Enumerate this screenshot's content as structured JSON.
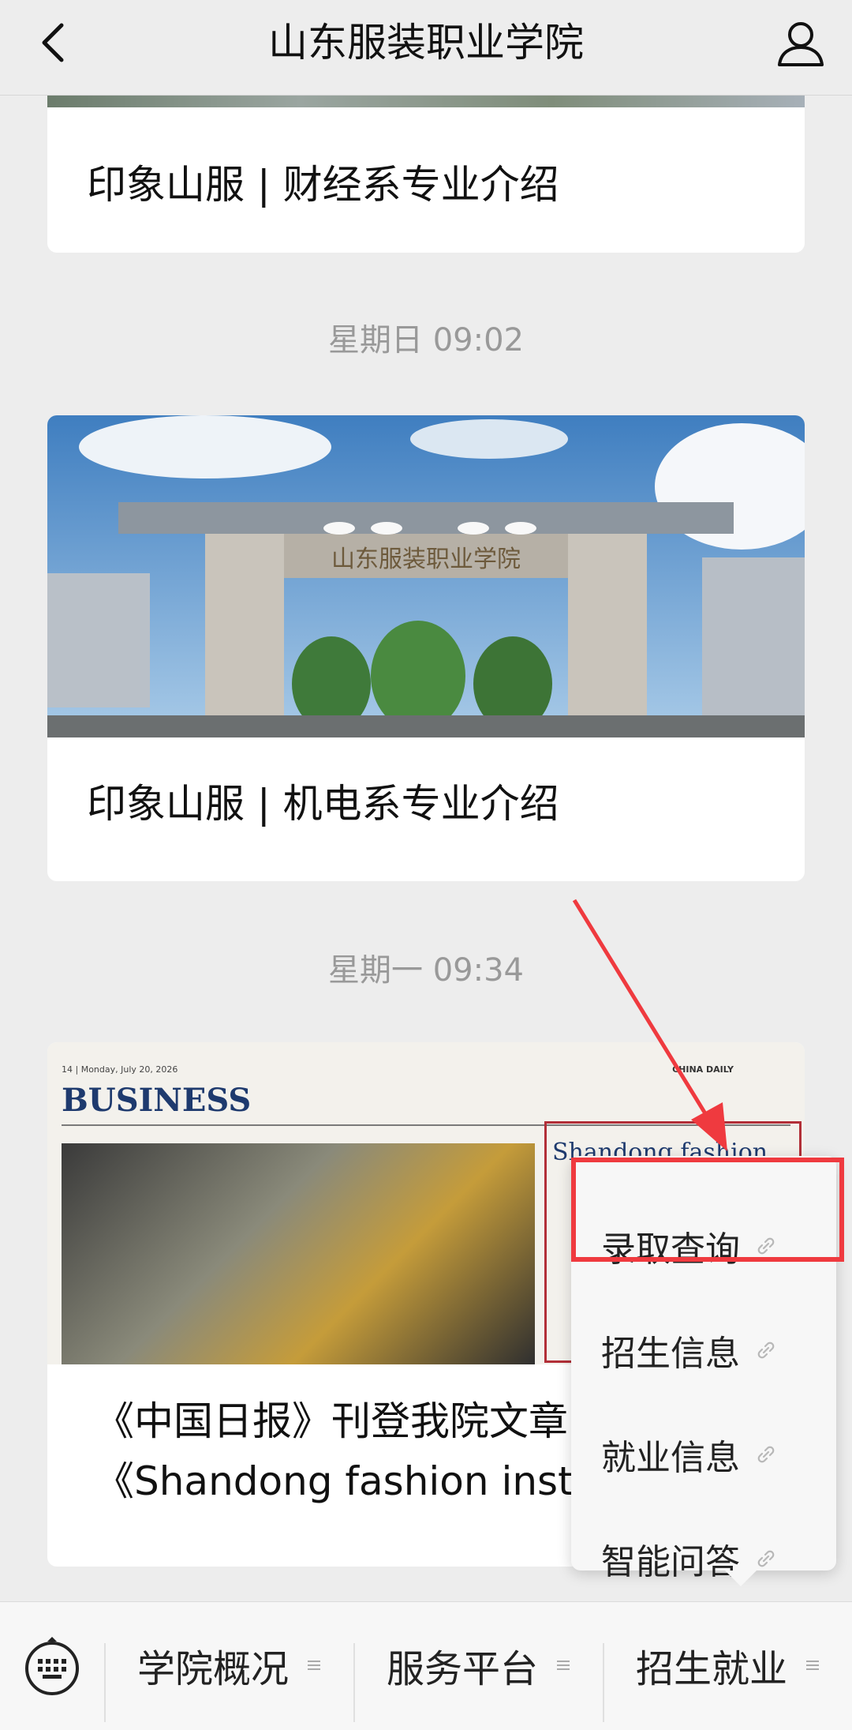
{
  "header": {
    "title": "山东服装职业学院"
  },
  "feed": [
    {
      "title": "印象山服 | 财经系专业介绍"
    },
    {
      "time": "星期日 09:02",
      "title": "印象山服 | 机电系专业介绍"
    },
    {
      "time": "星期一 09:34",
      "title_line1": "《中国日报》刊登我院文章",
      "title_line2": "《Shandong fashion institu"
    }
  ],
  "newspaper": {
    "page": "14",
    "date": "Monday, July 20, 2026",
    "brand": "CHINA DAILY",
    "section": "BUSINESS",
    "headline": "Shandong fashion"
  },
  "menu": [
    {
      "label": "录取查询",
      "icon": "link-icon"
    },
    {
      "label": "招生信息",
      "icon": "link-icon"
    },
    {
      "label": "就业信息",
      "icon": "link-icon"
    },
    {
      "label": "智能问答",
      "icon": "link-icon"
    }
  ],
  "bottom_tabs": [
    {
      "label": "学院概况"
    },
    {
      "label": "服务平台"
    },
    {
      "label": "招生就业"
    }
  ],
  "colors": {
    "highlight": "#ef3a3f",
    "background": "#ededed"
  }
}
